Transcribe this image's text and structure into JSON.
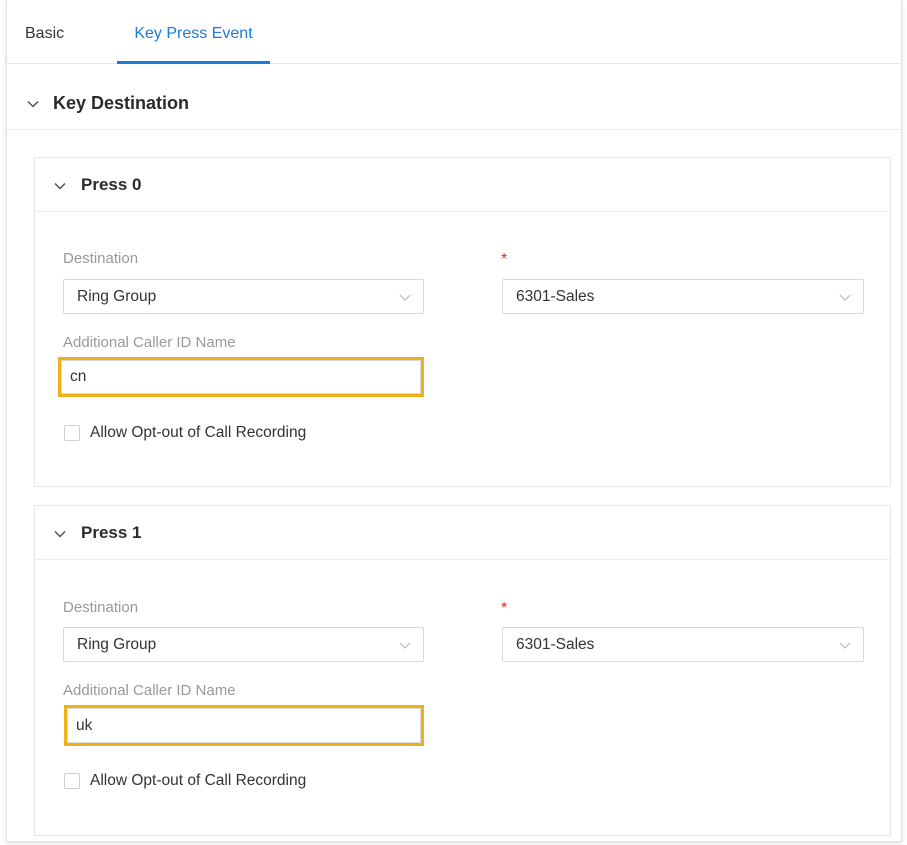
{
  "tabs": [
    {
      "label": "Basic",
      "active": false
    },
    {
      "label": "Key Press Event",
      "active": true
    }
  ],
  "section": {
    "title": "Key Destination"
  },
  "presses": [
    {
      "title": "Press 0",
      "destination_label": "Destination",
      "destination_value": "Ring Group",
      "required_mark": "*",
      "target_value": "6301-Sales",
      "caller_id_label": "Additional Caller ID Name",
      "caller_id_value": "cn",
      "opt_out_label": "Allow Opt-out of Call Recording",
      "opt_out_checked": false
    },
    {
      "title": "Press 1",
      "destination_label": "Destination",
      "destination_value": "Ring Group",
      "required_mark": "*",
      "target_value": "6301-Sales",
      "caller_id_label": "Additional Caller ID Name",
      "caller_id_value": "uk",
      "opt_out_label": "Allow Opt-out of Call Recording",
      "opt_out_checked": false
    }
  ],
  "colors": {
    "accent": "#1a7bd9",
    "highlight": "#eeb117",
    "required": "#d0342c"
  },
  "icons": {
    "collapse": "chevron-down-icon",
    "dropdown": "dropdown-arrow-icon"
  }
}
